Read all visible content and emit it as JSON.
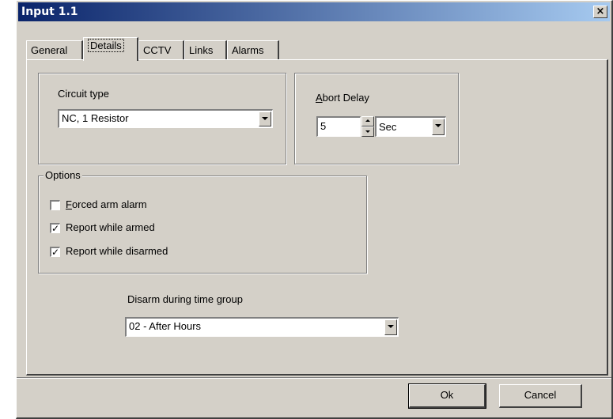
{
  "window": {
    "title": "Input 1.1",
    "close_glyph": "×"
  },
  "tabs": [
    {
      "label": "General",
      "active": false
    },
    {
      "label": "Details",
      "active": true
    },
    {
      "label": "CCTV",
      "active": false
    },
    {
      "label": "Links",
      "active": false
    },
    {
      "label": "Alarms",
      "active": false
    }
  ],
  "circuit": {
    "label": "Circuit type",
    "value": "NC, 1 Resistor"
  },
  "abort": {
    "label_first": "A",
    "label_rest": "bort Delay",
    "value": "5",
    "unit": "Sec"
  },
  "options": {
    "legend": "Options",
    "items": [
      {
        "label_first": "F",
        "label_rest": "orced arm alarm",
        "checked": false
      },
      {
        "label_first": "",
        "label_rest": "Report while armed",
        "checked": true
      },
      {
        "label_first": "",
        "label_rest": "Report while disarmed",
        "checked": true
      }
    ]
  },
  "disarm": {
    "label": "Disarm during time group",
    "value": "02 - After Hours"
  },
  "buttons": {
    "ok": "Ok",
    "cancel": "Cancel"
  },
  "check_glyph": "✓"
}
